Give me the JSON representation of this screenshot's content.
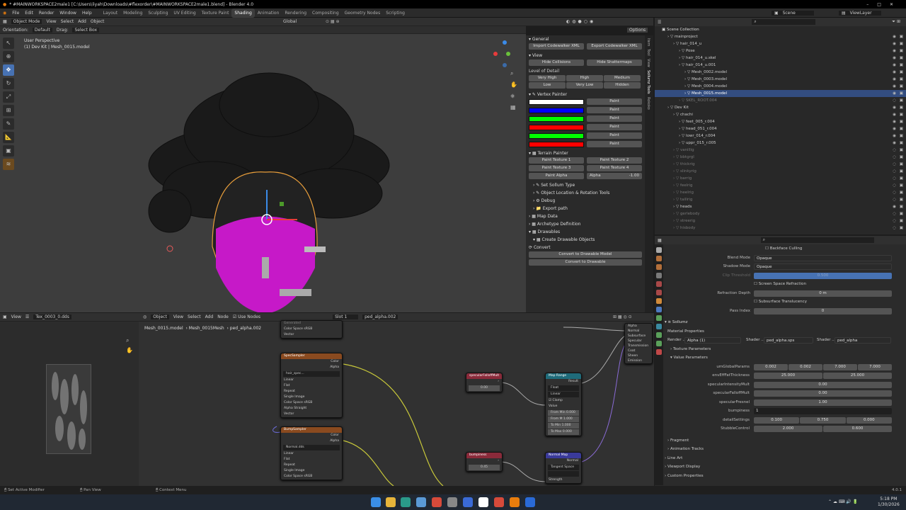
{
  "title": "* #MAINWORKSPACE2male1 [C:\\Users\\liyah\\Downloads\\#flexorder\\#MAINWORKSPACE2male1.blend] - Blender 4.0",
  "menu": [
    "File",
    "Edit",
    "Render",
    "Window",
    "Help"
  ],
  "workspaces": [
    "Layout",
    "Modeling",
    "Sculpting",
    "UV Editing",
    "Texture Paint",
    "Shading",
    "Animation",
    "Rendering",
    "Compositing",
    "Geometry Nodes",
    "Scripting"
  ],
  "scene": "Scene",
  "view_layer": "ViewLayer",
  "viewport_header": {
    "mode": "Object Mode",
    "items": [
      "View",
      "Select",
      "Add",
      "Object"
    ],
    "orientation_label": "Orientation:",
    "orientation": "Default",
    "drag_label": "Drag:",
    "drag": "Select Box",
    "transform": "Global",
    "options": "Options"
  },
  "viewport": {
    "perspective": "User Perspective",
    "object": "(1) Dev Kit | Mesh_0015.model"
  },
  "npanel": {
    "general": "General",
    "import_xml": "Import Codewalker XML",
    "export_xml": "Export Codewalker XML",
    "view": "View",
    "hide_collisions": "Hide Collisions",
    "hide_shattermaps": "Hide Shattermaps",
    "lod_label": "Level of Detail",
    "lod": [
      "Very High",
      "High",
      "Medium",
      "Low",
      "Very Low",
      "Hidden"
    ],
    "vertex_painter": "Vertex Painter",
    "paint": "Paint",
    "swatches": [
      "#ffffff",
      "#0000ff",
      "#00ff00",
      "#ff0000",
      "#00ff00",
      "#ff0000"
    ],
    "terrain_painter": "Terrain Painter",
    "terrain": [
      "Paint Texture 1",
      "Paint Texture 2",
      "Paint Texture 3",
      "Paint Texture 4",
      "Paint Alpha"
    ],
    "alpha_label": "Alpha",
    "alpha_value": "-1.00",
    "set_sollum": "Set Sollum Type",
    "obj_loc": "Object Location & Rotation Tools",
    "debug": "Debug",
    "export_path": "Export path",
    "map_data": "Map Data",
    "archetype": "Archetype Definition",
    "drawables": "Drawables",
    "create_drawable": "Create Drawable Objects",
    "convert": "Convert",
    "convert_model": "Convert to Drawable Model",
    "convert_drawable": "Convert to Drawable"
  },
  "vtabs": [
    "Item",
    "Tool",
    "View",
    "Sollumz Tools",
    "Rokoko"
  ],
  "outliner": {
    "root": "Scene Collection",
    "items": [
      {
        "label": "mainproject",
        "indent": 1,
        "dim": false,
        "sel": false
      },
      {
        "label": "hair_014_u",
        "indent": 2,
        "dim": false,
        "sel": false
      },
      {
        "label": "Pose",
        "indent": 3,
        "dim": false,
        "sel": false
      },
      {
        "label": "hair_014_u.skel",
        "indent": 3,
        "dim": false,
        "sel": false
      },
      {
        "label": "hair_014_u.001",
        "indent": 3,
        "dim": false,
        "sel": false
      },
      {
        "label": "Mesh_0002.model",
        "indent": 4,
        "dim": false,
        "sel": false
      },
      {
        "label": "Mesh_0003.model",
        "indent": 4,
        "dim": false,
        "sel": false
      },
      {
        "label": "Mesh_0004.model",
        "indent": 4,
        "dim": false,
        "sel": false
      },
      {
        "label": "Mesh_0015.model",
        "indent": 4,
        "dim": false,
        "sel": true
      },
      {
        "label": "SKEL_ROOT.004",
        "indent": 3,
        "dim": true,
        "sel": false
      },
      {
        "label": "Dev Kit",
        "indent": 1,
        "dim": false,
        "sel": false
      },
      {
        "label": "chachi",
        "indent": 2,
        "dim": false,
        "sel": false
      },
      {
        "label": "feet_005_r.004",
        "indent": 3,
        "dim": false,
        "sel": false
      },
      {
        "label": "head_051_r.004",
        "indent": 3,
        "dim": false,
        "sel": false
      },
      {
        "label": "lowr_014_r.004",
        "indent": 3,
        "dim": false,
        "sel": false
      },
      {
        "label": "uppr_015_r.005",
        "indent": 3,
        "dim": false,
        "sel": false
      },
      {
        "label": "vanillig",
        "indent": 2,
        "dim": true,
        "sel": false
      },
      {
        "label": "bbtgrgl",
        "indent": 2,
        "dim": true,
        "sel": false
      },
      {
        "label": "thickrig",
        "indent": 2,
        "dim": true,
        "sel": false
      },
      {
        "label": "slinkyrig",
        "indent": 2,
        "dim": true,
        "sel": false
      },
      {
        "label": "barrig",
        "indent": 2,
        "dim": true,
        "sel": false
      },
      {
        "label": "feelrig",
        "indent": 2,
        "dim": true,
        "sel": false
      },
      {
        "label": "heelrig",
        "indent": 2,
        "dim": true,
        "sel": false
      },
      {
        "label": "taillrig",
        "indent": 2,
        "dim": true,
        "sel": false
      },
      {
        "label": "heads",
        "indent": 2,
        "dim": false,
        "sel": false
      },
      {
        "label": "gerlebody",
        "indent": 2,
        "dim": true,
        "sel": false
      },
      {
        "label": "streerig",
        "indent": 2,
        "dim": true,
        "sel": false
      },
      {
        "label": "hisbody",
        "indent": 2,
        "dim": true,
        "sel": false
      }
    ]
  },
  "props": {
    "backface": "Backface Culling",
    "blend_mode_label": "Blend Mode",
    "blend_mode": "Opaque",
    "shadow_mode_label": "Shadow Mode",
    "shadow_mode": "Opaque",
    "clip_label": "Clip Threshold",
    "clip_value": "0.500",
    "ssr": "Screen Space Refraction",
    "refraction_label": "Refraction Depth",
    "refraction_value": "0 m",
    "subsurface": "Subsurface Translucency",
    "pass_label": "Pass Index",
    "pass_value": "0",
    "sollumz": "Sollumz",
    "material_props": "Material Properties",
    "render_label": "Render ...",
    "render_value": "Alpha (1)",
    "shader_label": "Shader ...",
    "shader_value": "ped_alpha.sps",
    "shader2_label": "Shader ...",
    "shader2_value": "ped_alpha",
    "texture_params": "Texture Parameters",
    "value_params": "Value Parameters",
    "params": [
      {
        "label": "umGlobalParams",
        "values": [
          "0.002",
          "0.002",
          "7.000",
          "7.000"
        ]
      },
      {
        "label": "envEffFatThickness",
        "values": [
          "25.000",
          "25.000"
        ]
      },
      {
        "label": "specularIntensityMult",
        "values": [
          "0.00"
        ]
      },
      {
        "label": "specularFalloffMult",
        "values": [
          "0.00"
        ]
      },
      {
        "label": "specularFresnel",
        "values": [
          "1.00"
        ]
      },
      {
        "label": "bumpiness",
        "values": [
          "1"
        ]
      },
      {
        "label": "detailSettings",
        "values": [
          "0.100",
          "0.750",
          "0.000"
        ]
      },
      {
        "label": "StubbleControl",
        "values": [
          "2.000",
          "0.600"
        ]
      }
    ],
    "footer": [
      "Fragment",
      "Animation Tracks",
      "Line Art",
      "Viewport Display",
      "Custom Properties"
    ]
  },
  "uv_header": {
    "view": "View",
    "image": "Tex_0003_0.dds"
  },
  "node_header": {
    "type": "Object",
    "items": [
      "View",
      "Select",
      "Add",
      "Node"
    ],
    "use_nodes": "Use Nodes",
    "slot": "Slot 1",
    "material": "ped_alpha.002"
  },
  "node_breadcrumb": [
    "Mesh_0015.model",
    "Mesh_0015Mesh",
    "ped_alpha.002"
  ],
  "nodes": {
    "spec": "SpecSampler",
    "bump": "BumpSampler",
    "spec_img": "hair_spec...",
    "bump_img": "Normal.dds",
    "falloff": "specularFalloffMult",
    "falloff_val": "0.00",
    "bumpiness": "bumpiness",
    "bumpiness_val": "0.45",
    "map_range": "Map Range",
    "normal_map": "Normal Map",
    "tangent": "Tangent Space",
    "strength": "Strength",
    "linear": "Linear",
    "flat": "Flat",
    "repeat": "Repeat",
    "single": "Single Image",
    "color_space": "Color Space",
    "srgb": "sRGB",
    "alpha_mode": "Straight",
    "color": "Color",
    "alpha": "Alpha",
    "vector": "Vector",
    "result": "Result",
    "normal": "Normal",
    "float": "Float",
    "clamp": "Clamp",
    "value": "Value",
    "from_min": "From Min",
    "from_min_v": "0.000",
    "from_max": "From M",
    "from_max_v": "1.000",
    "to_min": "To Min",
    "to_min_v": "1.000",
    "to_max": "To Max",
    "to_max_v": "0.000",
    "bsdf_items": [
      "Alpha",
      "Normal",
      "Subsurface",
      "Specular",
      "Transmission",
      "Coat",
      "Sheen",
      "Emission"
    ],
    "generated": "Generated",
    "input": "Input"
  },
  "status": {
    "left": "Set Active Modifier",
    "mid": "Pan View",
    "right": "Context Menu",
    "version": "4.0.1"
  },
  "taskbar": {
    "time": "5:18 PM",
    "date": "1/30/2026",
    "lang": "ENG"
  }
}
